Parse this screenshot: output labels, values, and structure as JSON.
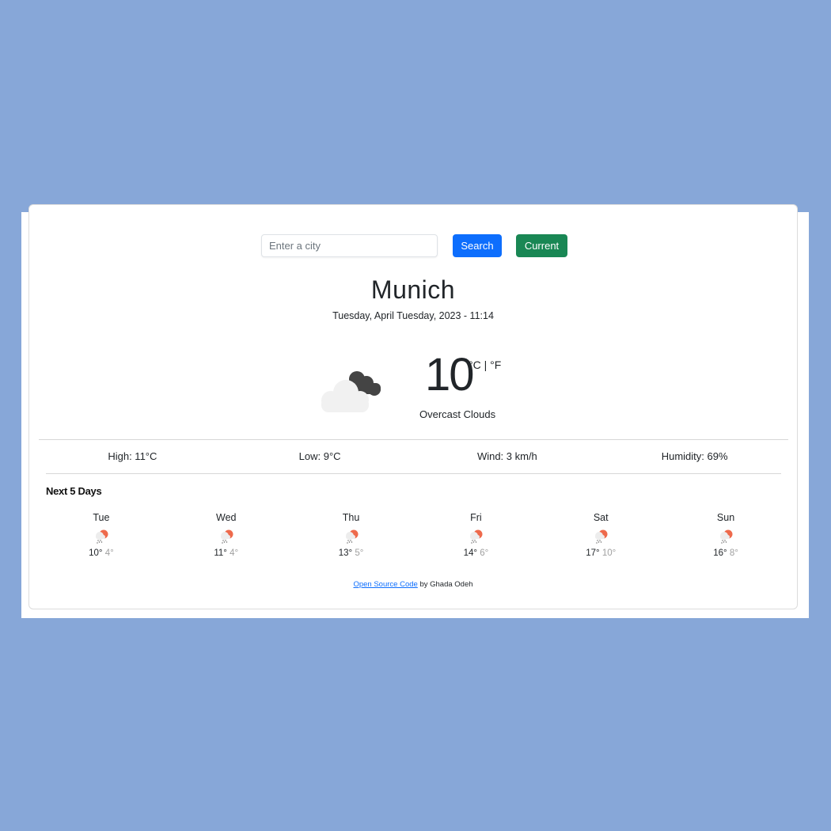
{
  "search": {
    "placeholder": "Enter a city",
    "value": "",
    "search_label": "Search",
    "current_label": "Current"
  },
  "current": {
    "city": "Munich",
    "date": "Tuesday, April Tuesday, 2023 - 11:14",
    "icon": "overcast-clouds-icon",
    "temperature": "10",
    "unit_celsius": "°C",
    "unit_separator": " | ",
    "unit_fahrenheit": "°F",
    "description": "Overcast Clouds"
  },
  "stats": {
    "high": "High: 11°C",
    "low": "Low: 9°C",
    "wind": "Wind: 3 km/h",
    "humidity": "Humidity: 69%"
  },
  "forecast": {
    "title": "Next 5 Days",
    "days": [
      {
        "name": "Tue",
        "icon": "rain-sun-icon",
        "max": "10°",
        "min": "4°"
      },
      {
        "name": "Wed",
        "icon": "rain-sun-icon",
        "max": "11°",
        "min": "4°"
      },
      {
        "name": "Thu",
        "icon": "rain-sun-icon",
        "max": "13°",
        "min": "5°"
      },
      {
        "name": "Fri",
        "icon": "rain-sun-icon",
        "max": "14°",
        "min": "6°"
      },
      {
        "name": "Sat",
        "icon": "rain-sun-icon",
        "max": "17°",
        "min": "10°"
      },
      {
        "name": "Sun",
        "icon": "rain-sun-icon",
        "max": "16°",
        "min": "8°"
      }
    ]
  },
  "footer": {
    "link_text": "Open Source Code",
    "suffix": " by Ghada Odeh"
  },
  "colors": {
    "background": "#87a7d8",
    "primary": "#0d6efd",
    "success": "#198754",
    "sun": "#ee6a4c"
  }
}
